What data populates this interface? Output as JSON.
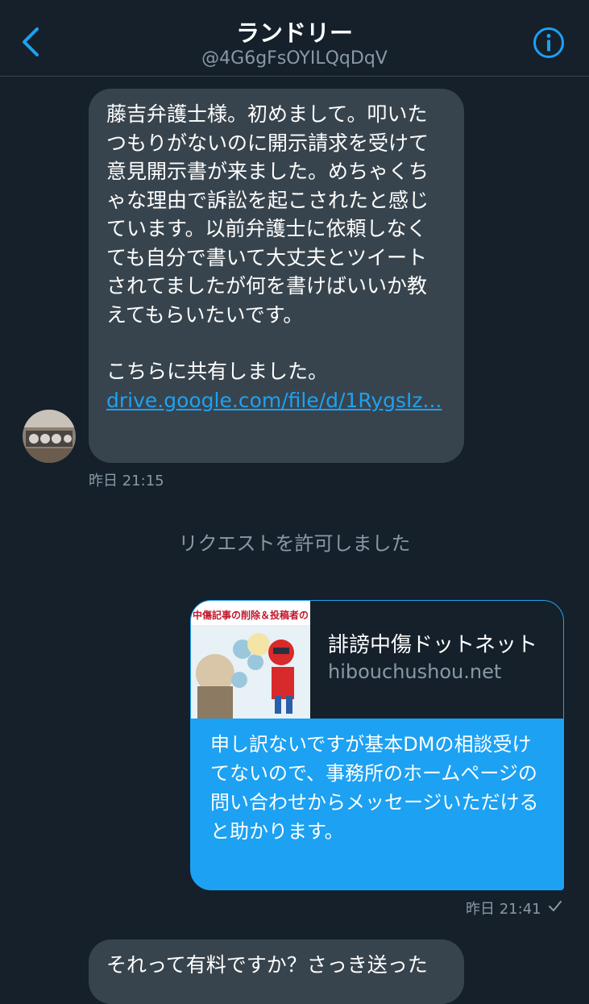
{
  "header": {
    "title": "ランドリー",
    "handle": "@4G6gFsOYILQqDqV"
  },
  "messages": {
    "incoming_1": {
      "paragraph_1": "藤吉弁護士様。初めまして。叩いたつもりがないのに開示請求を受けて意見開示書が来ました。めちゃくちゃな理由で訴訟を起こされたと感じています。以前弁護士に依頼しなくても自分で書いて大丈夫とツイートされてましたが何を書けばいいか教えてもらいたいです。",
      "paragraph_2": "こちらに共有しました。",
      "link": "drive.google.com/file/d/1RygsIz...",
      "timestamp": "昨日 21:15"
    },
    "system": "リクエストを許可しました",
    "outgoing_1": {
      "card_title": "誹謗中傷ドットネット",
      "card_domain": "hibouchushou.net",
      "thumb_caption": "中傷記事の削除＆投稿者の",
      "text": "申し訳ないですが基本DMの相談受けてないので、事務所のホームページの問い合わせからメッセージいただけると助かります。",
      "timestamp": "昨日 21:41",
      "status_icon": "check-icon"
    },
    "incoming_2": {
      "text": "それって有料ですか？さっき送った"
    }
  },
  "colors": {
    "background": "#15202b",
    "incoming_bubble": "#38444d",
    "outgoing_bubble": "#1da1f2",
    "secondary_text": "#8899a6",
    "accent": "#1da1f2"
  }
}
